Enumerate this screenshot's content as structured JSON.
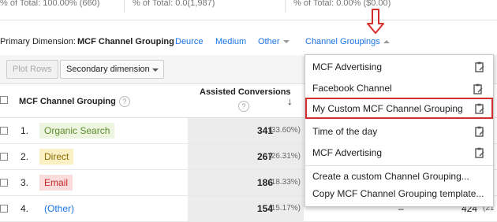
{
  "totals": [
    {
      "text": "% of Total: 100.00% (660)"
    },
    {
      "text": "% of Total: 0.0(1,987)"
    },
    {
      "text": "% of Total: 0.00% ($0.00)"
    }
  ],
  "primary_dimension": {
    "label": "Primary Dimension:",
    "active": "MCF Channel Grouping",
    "options": [
      "Deurce",
      "Medium",
      "Other"
    ],
    "channel_groupings": "Channel Groupings"
  },
  "toolbar": {
    "plot_rows": "Plot Rows",
    "secondary_dimension": "Secondary dimension"
  },
  "table": {
    "col_dimension": "MCF Channel Grouping",
    "col_metric": "Assisted Conversions",
    "help": "?",
    "sort_arrow": "↓",
    "rows": [
      {
        "num": "1.",
        "name": "Organic Search",
        "value": "341",
        "pct": "(33.60%)",
        "chip_bg": "#edf5e1",
        "chip_fg": "#5b8c2a"
      },
      {
        "num": "2.",
        "name": "Direct",
        "value": "267",
        "pct": "(26.31%)",
        "chip_bg": "#fbefc4",
        "chip_fg": "#8a6d00"
      },
      {
        "num": "3.",
        "name": "Email",
        "value": "186",
        "pct": "(18.33%)",
        "chip_bg": "#fbdcdc",
        "chip_fg": "#c62828"
      },
      {
        "num": "4.",
        "name": "(Other)",
        "value": "154",
        "pct": "(15.17%)",
        "chip_bg": "transparent",
        "chip_fg": "#1a73e8",
        "extra_dash": "–",
        "extra_value": "424",
        "extra_pct": "(21"
      }
    ]
  },
  "dropdown": {
    "items": [
      {
        "label": "MCF Advertising"
      },
      {
        "label": "Facebook Channel"
      },
      {
        "label": "My Custom MCF Channel Grouping"
      },
      {
        "label": "Time of the day"
      },
      {
        "label": "MCF Advertising"
      }
    ],
    "links": [
      "Create a custom Channel Grouping...",
      "Copy MCF Channel Grouping template..."
    ]
  },
  "colors": {
    "accent": "#1a73e8",
    "highlight_border": "#d32f2f",
    "annotation_arrow": "#d32f2f"
  }
}
